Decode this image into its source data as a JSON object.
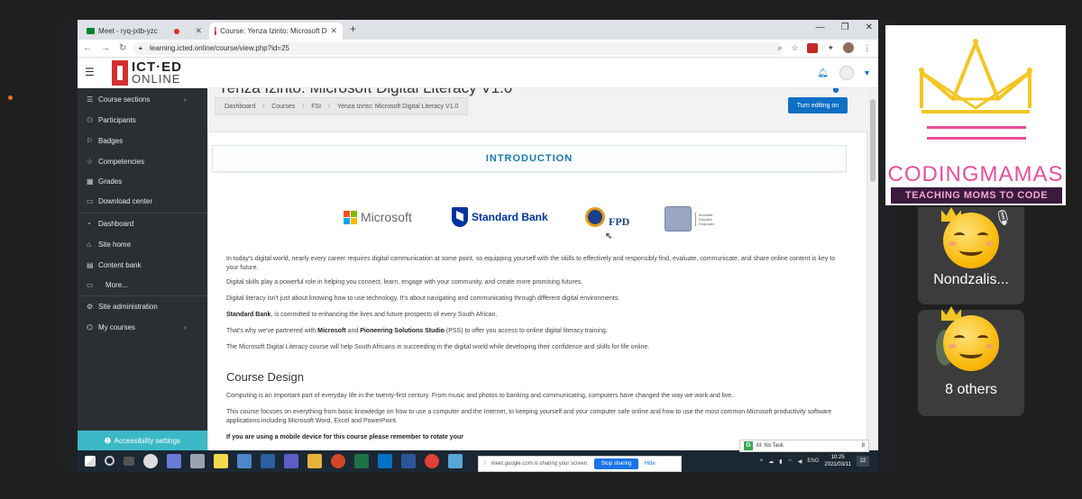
{
  "browser": {
    "tabs": [
      {
        "label": "Meet - ryq-jxtb-yzc",
        "recording": true
      },
      {
        "label": "Course: Yenza Izinto: Microsoft D",
        "active": true
      }
    ],
    "url": "learning.icted.online/course/view.php?id=25"
  },
  "header": {
    "logo_top": "ICT·ED",
    "logo_bottom": "ONLINE"
  },
  "sidebar": {
    "items": [
      {
        "label": "Course sections",
        "icon": "list-icon"
      },
      {
        "label": "Participants",
        "icon": "users-icon"
      },
      {
        "label": "Badges",
        "icon": "badge-icon"
      },
      {
        "label": "Competencies",
        "icon": "star-icon"
      },
      {
        "label": "Grades",
        "icon": "table-icon"
      },
      {
        "label": "Download center",
        "icon": "folder-icon"
      },
      {
        "label": "Dashboard",
        "icon": "dashboard-icon"
      },
      {
        "label": "Site home",
        "icon": "home-icon"
      },
      {
        "label": "Content bank",
        "icon": "clipboard-icon"
      },
      {
        "label": "More...",
        "icon": "folder-icon"
      },
      {
        "label": "Site administration",
        "icon": "gear-icon"
      },
      {
        "label": "My courses",
        "icon": "graduation-icon"
      }
    ],
    "accessibility": "Accessibility settings"
  },
  "page": {
    "title": "Yenza Izinto: Microsoft Digital Literacy V1.0",
    "breadcrumb": [
      "Dashboard",
      "Courses",
      "FSI",
      "Yenza Izinto: Microsoft Digital Literacy V1.0"
    ],
    "edit_button": "Turn editing on",
    "intro_heading": "INTRODUCTION",
    "logos": {
      "microsoft": "Microsoft",
      "standard_bank": "Standard Bank",
      "fpd": "FPD",
      "ps_tagline": [
        "Innovate.",
        "Educate.",
        "Empower."
      ]
    },
    "paragraphs": {
      "p1": "In today's digital world, nearly every career requires digital communication at some point, so equipping yourself with the skills to effectively and responsibly find, evaluate, communicate, and share online content is key to your future.",
      "p2": "Digital skills play a powerful role in helping you connect, learn, engage with your community, and create more promising futures.",
      "p3": "Digital literacy isn't just about knowing how to use technology. It's about navigating and communicating through different digital environments.",
      "p4_bold": "Standard Bank",
      "p4_rest": ", is committed to enhancing the lives and future prospects of every South African.",
      "p5_a": "That's why we've partnered with ",
      "p5_b": "Microsoft",
      "p5_c": " and ",
      "p5_d": "Pioneering Solutions Studio",
      "p5_e": " (PSS) to offer you access to online digital literacy training.",
      "p6": "The Microsoft Digital Literacy course will help South Africans in succeeding in the digital world while developing their confidence and skills for life online.",
      "h2": "Course Design",
      "p7": "Computing is an important part of everyday life in the twenty-first century. From music and photos to banking and communicating, computers have changed the way we work and live.",
      "p8": "This course focuses on everything from basic knowledge on how to use a computer and the Internet, to keeping yourself and your computer safe online and how to use the most common Microsoft productivity software applications including Microsoft Word, Excel and PowerPoint.",
      "p9": "If you are using a mobile device for this course please remember to rotate your"
    }
  },
  "share_bar": {
    "message": "meet.google.com is sharing your screen.",
    "stop": "Stop sharing",
    "hide": "Hide"
  },
  "task_widget": {
    "letter": "G",
    "label": "M: No Task",
    "count": "8"
  },
  "taskbar": {
    "lang": "ENG",
    "time": "10:25",
    "date": "2021/03/11",
    "notifications": "22"
  },
  "participants": {
    "presenter": {
      "title": "CODINGMAMAS",
      "tagline": "TEACHING MOMS TO CODE"
    },
    "tile1_name": "Nondzalis...",
    "tile2_name": "8 others"
  },
  "colors": {
    "accent_blue": "#0f6fc5",
    "sidebar_bg": "#2b2f33",
    "accessibility_bar": "#3bb9c7",
    "codingmamas_pink": "#e94e9c"
  }
}
